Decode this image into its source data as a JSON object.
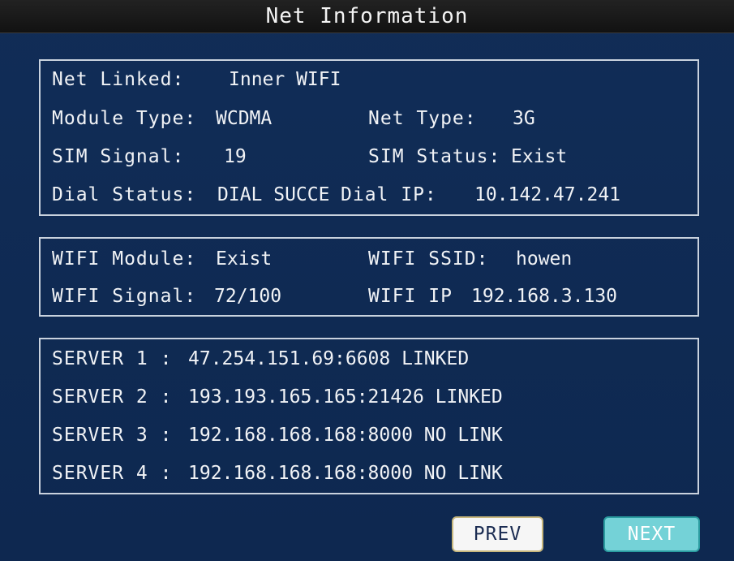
{
  "header": {
    "title": "Net Information"
  },
  "network": {
    "net_linked_label": "Net Linked:",
    "net_linked_value": "Inner WIFI",
    "module_type_label": "Module Type:",
    "module_type_value": "WCDMA",
    "net_type_label": "Net Type:",
    "net_type_value": "3G",
    "sim_signal_label": "SIM Signal:",
    "sim_signal_value": "19",
    "sim_status_label": "SIM Status:",
    "sim_status_value": "Exist",
    "dial_status_label": "Dial Status:",
    "dial_status_value": "DIAL SUCCE",
    "dial_ip_label": "Dial IP:",
    "dial_ip_value": "10.142.47.241"
  },
  "wifi": {
    "module_label": "WIFI Module:",
    "module_value": "Exist",
    "ssid_label": "WIFI SSID:",
    "ssid_value": "howen",
    "signal_label": "WIFI Signal:",
    "signal_value": "72/100",
    "ip_label": "WIFI IP",
    "ip_value": "192.168.3.130"
  },
  "servers": [
    {
      "label": "SERVER 1 :",
      "value": "47.254.151.69:6608 LINKED"
    },
    {
      "label": "SERVER 2 :",
      "value": "193.193.165.165:21426 LINKED"
    },
    {
      "label": "SERVER 3 :",
      "value": "192.168.168.168:8000 NO LINK"
    },
    {
      "label": "SERVER 4 :",
      "value": "192.168.168.168:8000 NO LINK"
    }
  ],
  "buttons": {
    "prev_label": "PREV",
    "next_label": "NEXT"
  },
  "colors": {
    "background": "#0f2a53",
    "title_bar": "#121212",
    "panel_border": "#c9d2de",
    "text": "#f1f3f6",
    "prev_button": "#f6f6f6",
    "next_button": "#74d2d7"
  }
}
